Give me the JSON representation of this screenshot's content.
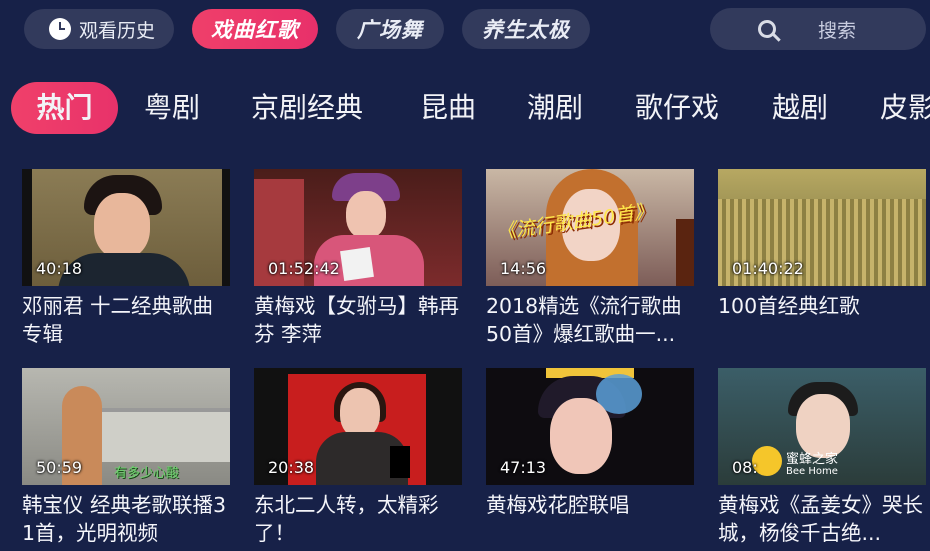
{
  "topbar": {
    "history_label": "观看历史",
    "channels": [
      {
        "label": "戏曲红歌",
        "active": true
      },
      {
        "label": "广场舞",
        "active": false
      },
      {
        "label": "养生太极",
        "active": false
      }
    ],
    "search_placeholder": "搜索"
  },
  "categories": [
    "热门",
    "粤剧",
    "京剧经典",
    "昆曲",
    "潮剧",
    "歌仔戏",
    "越剧",
    "皮影"
  ],
  "videos": [
    {
      "duration": "40:18",
      "title": "邓丽君  十二经典歌曲专辑"
    },
    {
      "duration": "01:52:42",
      "title": "黄梅戏【女驸马】韩再芬 李萍"
    },
    {
      "duration": "14:56",
      "title": "2018精选《流行歌曲50首》爆红歌曲一..."
    },
    {
      "duration": "01:40:22",
      "title": "100首经典红歌"
    },
    {
      "duration": "50:59",
      "title": "韩宝仪 经典老歌联播31首，光明视频"
    },
    {
      "duration": "20:38",
      "title": "东北二人转，太精彩了！"
    },
    {
      "duration": "47:13",
      "title": "黄梅戏花腔联唱"
    },
    {
      "duration": "08:",
      "title": "黄梅戏《孟姜女》哭长城，杨俊千古绝..."
    }
  ],
  "thumb_text": {
    "t3_overlay": "《流行歌曲50首》",
    "t5_overlay": "有多少心酸",
    "t8_logo": "蜜蜂之家",
    "t8_logo_en": "Bee Home"
  },
  "colors": {
    "background": "#172148",
    "active_accent": "#ef3f6a",
    "pill_bg": "#323a5c"
  }
}
